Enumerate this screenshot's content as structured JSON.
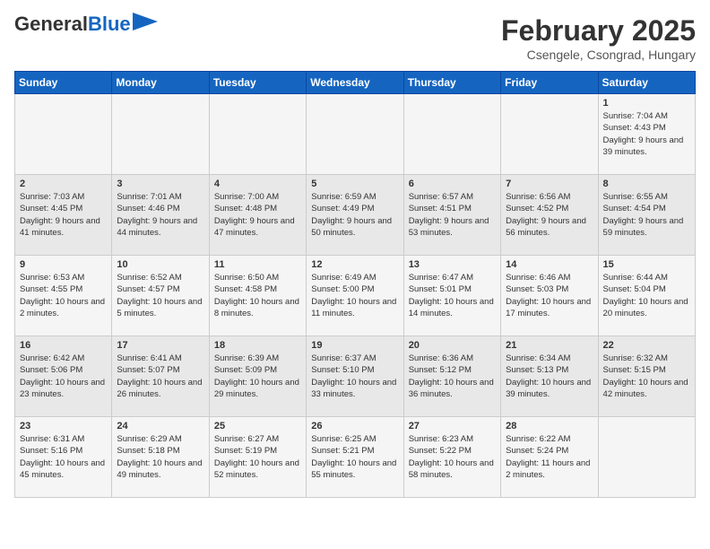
{
  "header": {
    "logo_general": "General",
    "logo_blue": "Blue",
    "title": "February 2025",
    "subtitle": "Csengele, Csongrad, Hungary"
  },
  "days_of_week": [
    "Sunday",
    "Monday",
    "Tuesday",
    "Wednesday",
    "Thursday",
    "Friday",
    "Saturday"
  ],
  "weeks": [
    [
      {
        "day": "",
        "info": ""
      },
      {
        "day": "",
        "info": ""
      },
      {
        "day": "",
        "info": ""
      },
      {
        "day": "",
        "info": ""
      },
      {
        "day": "",
        "info": ""
      },
      {
        "day": "",
        "info": ""
      },
      {
        "day": "1",
        "info": "Sunrise: 7:04 AM\nSunset: 4:43 PM\nDaylight: 9 hours\nand 39 minutes."
      }
    ],
    [
      {
        "day": "2",
        "info": "Sunrise: 7:03 AM\nSunset: 4:45 PM\nDaylight: 9 hours\nand 41 minutes."
      },
      {
        "day": "3",
        "info": "Sunrise: 7:01 AM\nSunset: 4:46 PM\nDaylight: 9 hours\nand 44 minutes."
      },
      {
        "day": "4",
        "info": "Sunrise: 7:00 AM\nSunset: 4:48 PM\nDaylight: 9 hours\nand 47 minutes."
      },
      {
        "day": "5",
        "info": "Sunrise: 6:59 AM\nSunset: 4:49 PM\nDaylight: 9 hours\nand 50 minutes."
      },
      {
        "day": "6",
        "info": "Sunrise: 6:57 AM\nSunset: 4:51 PM\nDaylight: 9 hours\nand 53 minutes."
      },
      {
        "day": "7",
        "info": "Sunrise: 6:56 AM\nSunset: 4:52 PM\nDaylight: 9 hours\nand 56 minutes."
      },
      {
        "day": "8",
        "info": "Sunrise: 6:55 AM\nSunset: 4:54 PM\nDaylight: 9 hours\nand 59 minutes."
      }
    ],
    [
      {
        "day": "9",
        "info": "Sunrise: 6:53 AM\nSunset: 4:55 PM\nDaylight: 10 hours\nand 2 minutes."
      },
      {
        "day": "10",
        "info": "Sunrise: 6:52 AM\nSunset: 4:57 PM\nDaylight: 10 hours\nand 5 minutes."
      },
      {
        "day": "11",
        "info": "Sunrise: 6:50 AM\nSunset: 4:58 PM\nDaylight: 10 hours\nand 8 minutes."
      },
      {
        "day": "12",
        "info": "Sunrise: 6:49 AM\nSunset: 5:00 PM\nDaylight: 10 hours\nand 11 minutes."
      },
      {
        "day": "13",
        "info": "Sunrise: 6:47 AM\nSunset: 5:01 PM\nDaylight: 10 hours\nand 14 minutes."
      },
      {
        "day": "14",
        "info": "Sunrise: 6:46 AM\nSunset: 5:03 PM\nDaylight: 10 hours\nand 17 minutes."
      },
      {
        "day": "15",
        "info": "Sunrise: 6:44 AM\nSunset: 5:04 PM\nDaylight: 10 hours\nand 20 minutes."
      }
    ],
    [
      {
        "day": "16",
        "info": "Sunrise: 6:42 AM\nSunset: 5:06 PM\nDaylight: 10 hours\nand 23 minutes."
      },
      {
        "day": "17",
        "info": "Sunrise: 6:41 AM\nSunset: 5:07 PM\nDaylight: 10 hours\nand 26 minutes."
      },
      {
        "day": "18",
        "info": "Sunrise: 6:39 AM\nSunset: 5:09 PM\nDaylight: 10 hours\nand 29 minutes."
      },
      {
        "day": "19",
        "info": "Sunrise: 6:37 AM\nSunset: 5:10 PM\nDaylight: 10 hours\nand 33 minutes."
      },
      {
        "day": "20",
        "info": "Sunrise: 6:36 AM\nSunset: 5:12 PM\nDaylight: 10 hours\nand 36 minutes."
      },
      {
        "day": "21",
        "info": "Sunrise: 6:34 AM\nSunset: 5:13 PM\nDaylight: 10 hours\nand 39 minutes."
      },
      {
        "day": "22",
        "info": "Sunrise: 6:32 AM\nSunset: 5:15 PM\nDaylight: 10 hours\nand 42 minutes."
      }
    ],
    [
      {
        "day": "23",
        "info": "Sunrise: 6:31 AM\nSunset: 5:16 PM\nDaylight: 10 hours\nand 45 minutes."
      },
      {
        "day": "24",
        "info": "Sunrise: 6:29 AM\nSunset: 5:18 PM\nDaylight: 10 hours\nand 49 minutes."
      },
      {
        "day": "25",
        "info": "Sunrise: 6:27 AM\nSunset: 5:19 PM\nDaylight: 10 hours\nand 52 minutes."
      },
      {
        "day": "26",
        "info": "Sunrise: 6:25 AM\nSunset: 5:21 PM\nDaylight: 10 hours\nand 55 minutes."
      },
      {
        "day": "27",
        "info": "Sunrise: 6:23 AM\nSunset: 5:22 PM\nDaylight: 10 hours\nand 58 minutes."
      },
      {
        "day": "28",
        "info": "Sunrise: 6:22 AM\nSunset: 5:24 PM\nDaylight: 11 hours\nand 2 minutes."
      },
      {
        "day": "",
        "info": ""
      }
    ]
  ]
}
